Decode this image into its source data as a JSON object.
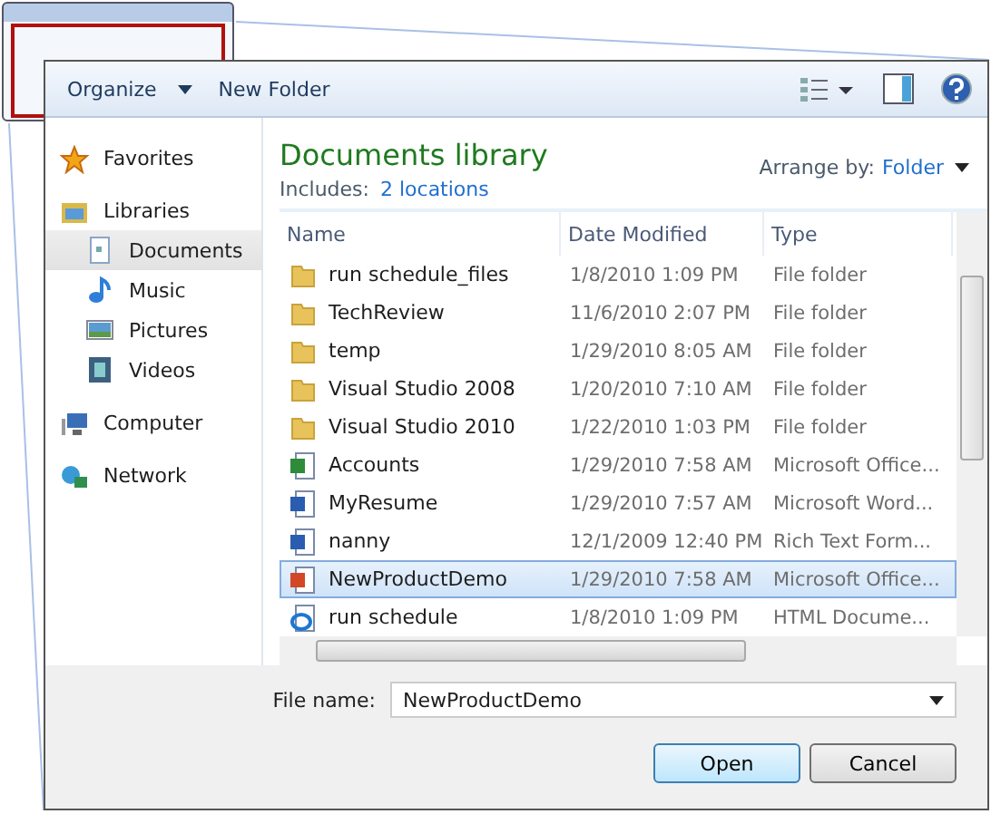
{
  "toolbar": {
    "organize": "Organize",
    "new_folder": "New Folder"
  },
  "sidebar": {
    "items": [
      {
        "label": "Favorites",
        "kind": "star",
        "selected": false
      },
      {
        "label": "Libraries",
        "kind": "library",
        "selected": false,
        "children": [
          {
            "label": "Documents",
            "kind": "document",
            "selected": true
          },
          {
            "label": "Music",
            "kind": "music",
            "selected": false
          },
          {
            "label": "Pictures",
            "kind": "picture",
            "selected": false
          },
          {
            "label": "Videos",
            "kind": "video",
            "selected": false
          }
        ]
      },
      {
        "label": "Computer",
        "kind": "computer",
        "selected": false
      },
      {
        "label": "Network",
        "kind": "network",
        "selected": false
      }
    ]
  },
  "library": {
    "title": "Documents library",
    "includes_label": "Includes:",
    "includes_link": "2 locations",
    "arrange_label": "Arrange by:",
    "arrange_value": "Folder"
  },
  "table": {
    "columns": [
      "Name",
      "Date Modified",
      "Type"
    ],
    "rows": [
      {
        "name": "run schedule_files",
        "date": "1/8/2010 1:09 PM",
        "type": "File folder",
        "kind": "folder",
        "selected": false
      },
      {
        "name": "TechReview",
        "date": "11/6/2010 2:07 PM",
        "type": "File folder",
        "kind": "folder",
        "selected": false
      },
      {
        "name": "temp",
        "date": "1/29/2010 8:05 AM",
        "type": "File folder",
        "kind": "folder",
        "selected": false
      },
      {
        "name": "Visual Studio 2008",
        "date": "1/20/2010 7:10 AM",
        "type": "File folder",
        "kind": "folder",
        "selected": false
      },
      {
        "name": "Visual Studio 2010",
        "date": "1/22/2010 1:03 PM",
        "type": "File folder",
        "kind": "folder",
        "selected": false
      },
      {
        "name": "Accounts",
        "date": "1/29/2010 7:58 AM",
        "type": "Microsoft Office...",
        "kind": "spreadsheet",
        "selected": false
      },
      {
        "name": "MyResume",
        "date": "1/29/2010 7:57 AM",
        "type": "Microsoft Word...",
        "kind": "word",
        "selected": false
      },
      {
        "name": "nanny",
        "date": "12/1/2009 12:40 PM",
        "type": "Rich Text Form...",
        "kind": "word",
        "selected": false
      },
      {
        "name": "NewProductDemo",
        "date": "1/29/2010 7:58 AM",
        "type": "Microsoft Office...",
        "kind": "presentation",
        "selected": true
      },
      {
        "name": "run schedule",
        "date": "1/8/2010 1:09 PM",
        "type": "HTML Docume...",
        "kind": "web",
        "selected": false
      }
    ]
  },
  "file_name": {
    "label": "File name:",
    "value": "NewProductDemo"
  },
  "buttons": [
    {
      "label": "Open",
      "default": true
    },
    {
      "label": "Cancel",
      "default": false
    }
  ]
}
